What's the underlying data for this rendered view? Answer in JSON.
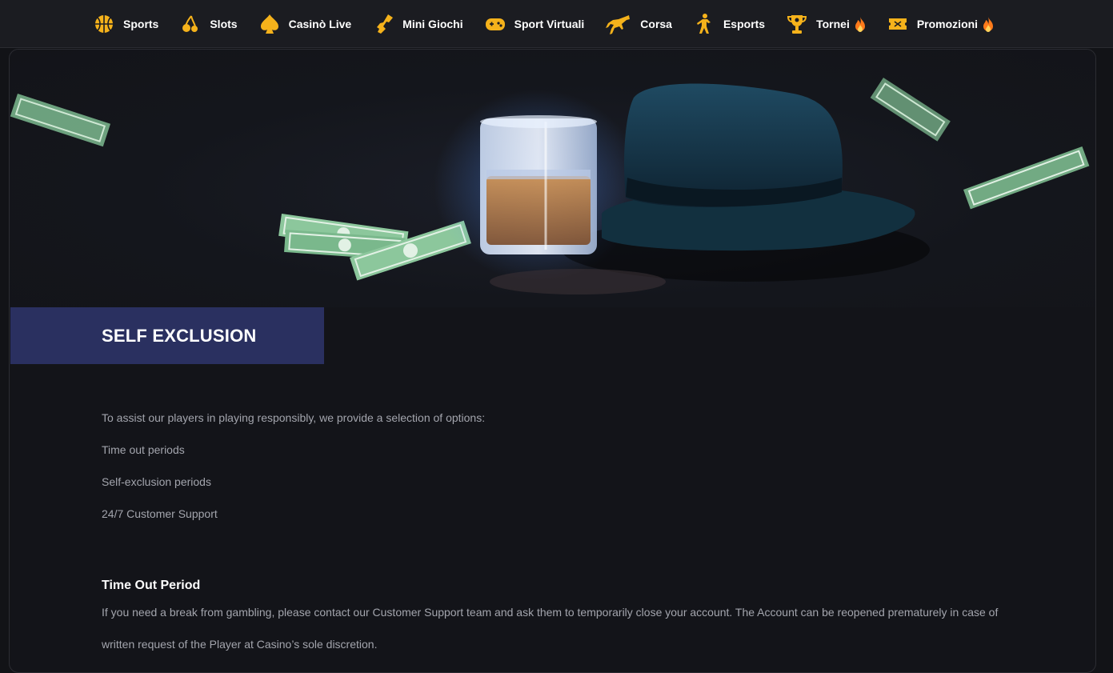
{
  "nav": {
    "items": [
      {
        "label": "Sports",
        "icon": "basketball-icon"
      },
      {
        "label": "Slots",
        "icon": "cherries-icon"
      },
      {
        "label": "Casinò Live",
        "icon": "spade-icon"
      },
      {
        "label": "Mini Giochi",
        "icon": "rocket-man-icon"
      },
      {
        "label": "Sport Virtuali",
        "icon": "gamepad-icon"
      },
      {
        "label": "Corsa",
        "icon": "horse-jump-icon"
      },
      {
        "label": "Esports",
        "icon": "soldier-icon"
      },
      {
        "label": "Tornei",
        "icon": "trophy-icon",
        "hot": true
      },
      {
        "label": "Promozioni",
        "icon": "ticket-icon",
        "hot": true
      }
    ],
    "accent": "#f5b21b",
    "hot_color": "#ff7a1a"
  },
  "page": {
    "title": "SELF EXCLUSION",
    "banner_color": "#2a3060",
    "intro": "To assist our players in playing responsibly, we provide a selection of options:",
    "options": [
      "Time out periods",
      "Self-exclusion periods",
      "24/7 Customer Support"
    ],
    "section": {
      "heading": "Time Out Period",
      "body": "If you need a break from gambling, please contact our Customer Support team and ask them to temporarily close your account. The Account can be reopened prematurely in case of written request of the Player at Casino’s sole discretion."
    }
  }
}
